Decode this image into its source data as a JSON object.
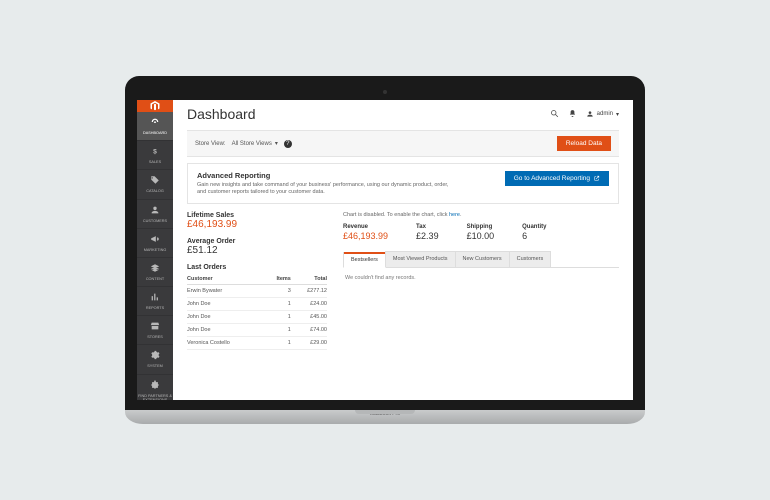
{
  "page": {
    "title": "Dashboard"
  },
  "user": {
    "label": "admin"
  },
  "scope": {
    "label": "Store View:",
    "value": "All Store Views",
    "reload_button": "Reload Data"
  },
  "advanced_reporting": {
    "heading": "Advanced Reporting",
    "body": "Gain new insights and take command of your business' performance, using our dynamic product, order, and customer reports tailored to your customer data.",
    "cta": "Go to Advanced Reporting"
  },
  "stats": {
    "lifetime_sales": {
      "label": "Lifetime Sales",
      "value": "£46,193.99"
    },
    "average_order": {
      "label": "Average Order",
      "value": "£51.12"
    }
  },
  "last_orders": {
    "heading": "Last Orders",
    "columns": {
      "customer": "Customer",
      "items": "Items",
      "total": "Total"
    },
    "rows": [
      {
        "customer": "Erwin Bywater",
        "items": "3",
        "total": "£277.12"
      },
      {
        "customer": "John Doe",
        "items": "1",
        "total": "£24.00"
      },
      {
        "customer": "John Doe",
        "items": "1",
        "total": "£45.00"
      },
      {
        "customer": "John Doe",
        "items": "1",
        "total": "£74.00"
      },
      {
        "customer": "Veronica Costello",
        "items": "1",
        "total": "£29.00"
      }
    ]
  },
  "chart": {
    "disabled_prefix": "Chart is disabled. To enable the chart, click ",
    "disabled_link": "here",
    "summary": {
      "revenue": {
        "label": "Revenue",
        "value": "£46,193.99"
      },
      "tax": {
        "label": "Tax",
        "value": "£2.39"
      },
      "shipping": {
        "label": "Shipping",
        "value": "£10.00"
      },
      "quantity": {
        "label": "Quantity",
        "value": "6"
      }
    }
  },
  "tabs": {
    "items": [
      "Bestsellers",
      "Most Viewed Products",
      "New Customers",
      "Customers"
    ],
    "active_index": 0,
    "empty_message": "We couldn't find any records."
  },
  "sidebar": {
    "items": [
      {
        "label": "DASHBOARD",
        "icon": "speedometer"
      },
      {
        "label": "SALES",
        "icon": "dollar"
      },
      {
        "label": "CATALOG",
        "icon": "tag"
      },
      {
        "label": "CUSTOMERS",
        "icon": "person"
      },
      {
        "label": "MARKETING",
        "icon": "megaphone"
      },
      {
        "label": "CONTENT",
        "icon": "layers"
      },
      {
        "label": "REPORTS",
        "icon": "bars"
      },
      {
        "label": "STORES",
        "icon": "storefront"
      },
      {
        "label": "SYSTEM",
        "icon": "gear"
      },
      {
        "label": "FIND PARTNERS & EXTENSIONS",
        "icon": "puzzle"
      }
    ]
  },
  "device": {
    "label": "MacBook Pro"
  }
}
